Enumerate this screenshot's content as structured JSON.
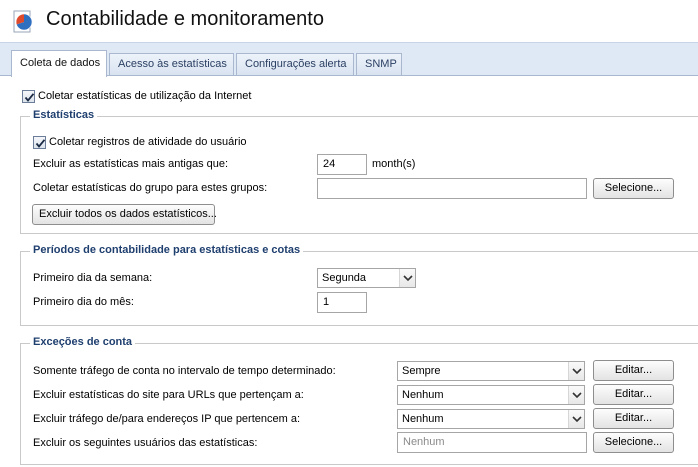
{
  "header": {
    "title": "Contabilidade e monitoramento",
    "icon": "pie-chart-document-icon"
  },
  "tabs": [
    {
      "label": "Coleta de dados",
      "active": true
    },
    {
      "label": "Acesso às estatísticas",
      "active": false
    },
    {
      "label": "Configurações alerta",
      "active": false
    },
    {
      "label": "SNMP",
      "active": false
    }
  ],
  "main": {
    "collect_internet": {
      "label": "Coletar estatísticas de utilização da Internet",
      "checked": true
    }
  },
  "statistics": {
    "title": "Estatísticas",
    "collect_activity": {
      "label": "Coletar registros de atividade do usuário",
      "checked": true
    },
    "delete_older": {
      "label": "Excluir as estatísticas mais antigas que:",
      "value": "24",
      "unit": "month(s)"
    },
    "group_collect": {
      "label": "Coletar estatísticas do grupo para estes grupos:",
      "value": "",
      "button": "Selecione..."
    },
    "delete_all_button": "Excluir todos os dados estatísticos..."
  },
  "periods": {
    "title": "Períodos de contabilidade para estatísticas e cotas",
    "first_weekday": {
      "label": "Primeiro dia da semana:",
      "value": "Segunda"
    },
    "first_monthday": {
      "label": "Primeiro dia do mês:",
      "value": "1"
    }
  },
  "exceptions": {
    "title": "Exceções de conta",
    "rows": [
      {
        "label": "Somente tráfego de conta no intervalo de tempo determinado:",
        "value": "Sempre",
        "button": "Editar..."
      },
      {
        "label": "Excluir estatísticas do site para URLs que pertençam a:",
        "value": "Nenhum",
        "button": "Editar..."
      },
      {
        "label": "Excluir tráfego de/para endereços IP que pertencem a:",
        "value": "Nenhum",
        "button": "Editar..."
      },
      {
        "label": "Excluir os seguintes usuários das estatísticas:",
        "value": "Nenhum",
        "button": "Selecione..."
      }
    ]
  },
  "colors": {
    "accent": "#1f3f6f",
    "tab_bar": "#dfe8f5"
  }
}
